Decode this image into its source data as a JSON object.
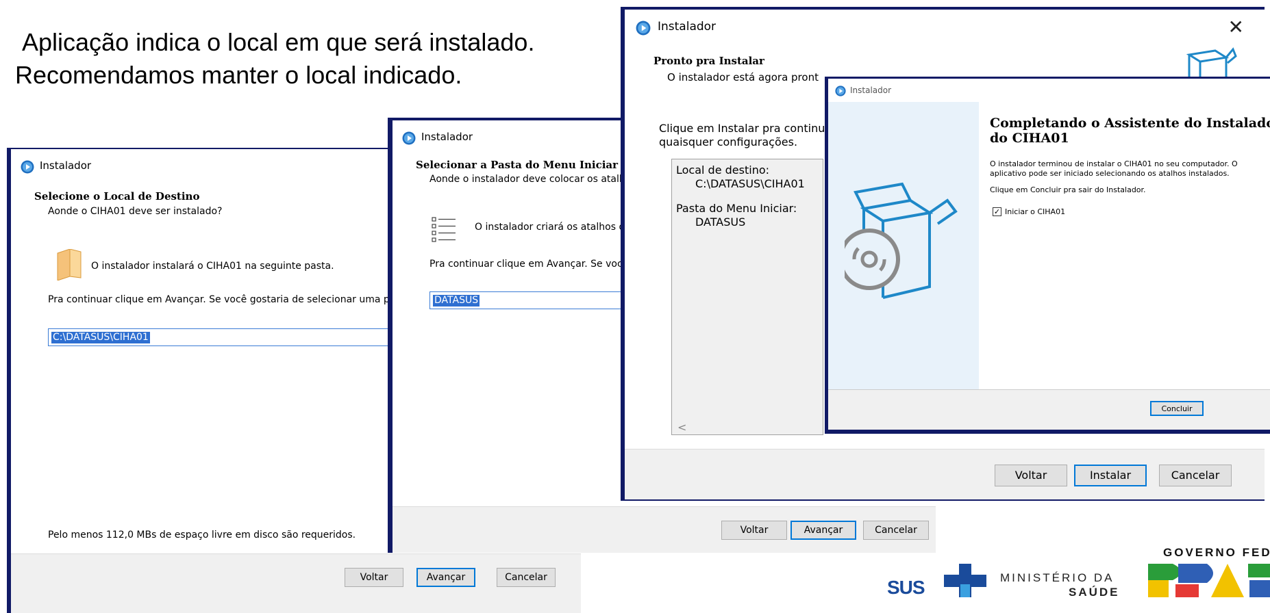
{
  "intro": {
    "line1": "Aplicação indica o local em que será instalado.",
    "line2": "Recomendamos manter o local indicado."
  },
  "window_destination": {
    "title": "Instalador",
    "heading": "Selecione o Local de Destino",
    "subheading": "Aonde o CIHA01 deve ser instalado?",
    "info": "O instalador instalará o CIHA01 na seguinte pasta.",
    "instruction": "Pra continuar clique em Avançar. Se você gostaria de selecionar uma past",
    "path_value": "C:\\DATASUS\\CIHA01",
    "disk_space": "Pelo menos 112,0 MBs de espaço livre em disco são requeridos.",
    "buttons": {
      "back": "Voltar",
      "next": "Avançar",
      "cancel": "Cancelar"
    }
  },
  "window_startmenu": {
    "title": "Instalador",
    "heading": "Selecionar a Pasta do Menu Iniciar",
    "subheading": "Aonde o instalador deve colocar os atalh",
    "info": "O instalador criará os atalhos d",
    "instruction": "Pra continuar clique em Avançar. Se voc",
    "folder_value": "DATASUS",
    "buttons": {
      "back": "Voltar",
      "next": "Avançar",
      "cancel": "Cancelar"
    }
  },
  "window_ready": {
    "title": "Instalador",
    "heading": "Pronto pra Instalar",
    "subheading": "O instalador está agora pront",
    "instruction_line1": "Clique em Instalar pra continu",
    "instruction_line2": "quaisquer configurações.",
    "summary": {
      "dest_label": "Local de destino:",
      "dest_value": "C:\\DATASUS\\CIHA01",
      "menu_label": "Pasta do Menu Iniciar:",
      "menu_value": "DATASUS",
      "scroll_left": "<"
    },
    "buttons": {
      "back": "Voltar",
      "install": "Instalar",
      "cancel": "Cancelar"
    }
  },
  "window_finish": {
    "title": "Instalador",
    "heading_line1": "Completando o Assistente do Instalador",
    "heading_line2": "do CIHA01",
    "text_line1": "O instalador terminou de instalar o CIHA01 no seu computador. O",
    "text_line2": "aplicativo pode ser iniciado selecionando os atalhos instalados.",
    "text_line3": "Clique em Concluir pra sair do Instalador.",
    "checkbox_label": "Iniciar o CIHA01",
    "checkbox_checked": true,
    "button_finish": "Concluir"
  },
  "branding": {
    "sus": "SUS",
    "ministry_line1": "MINISTÉRIO DA",
    "ministry_line2": "SAÚDE",
    "government": "GOVERNO FED"
  },
  "colors": {
    "window_border": "#111a66",
    "accent": "#0078d7",
    "selection": "#2e6fd1",
    "icon_blue": "#1e88c8"
  }
}
